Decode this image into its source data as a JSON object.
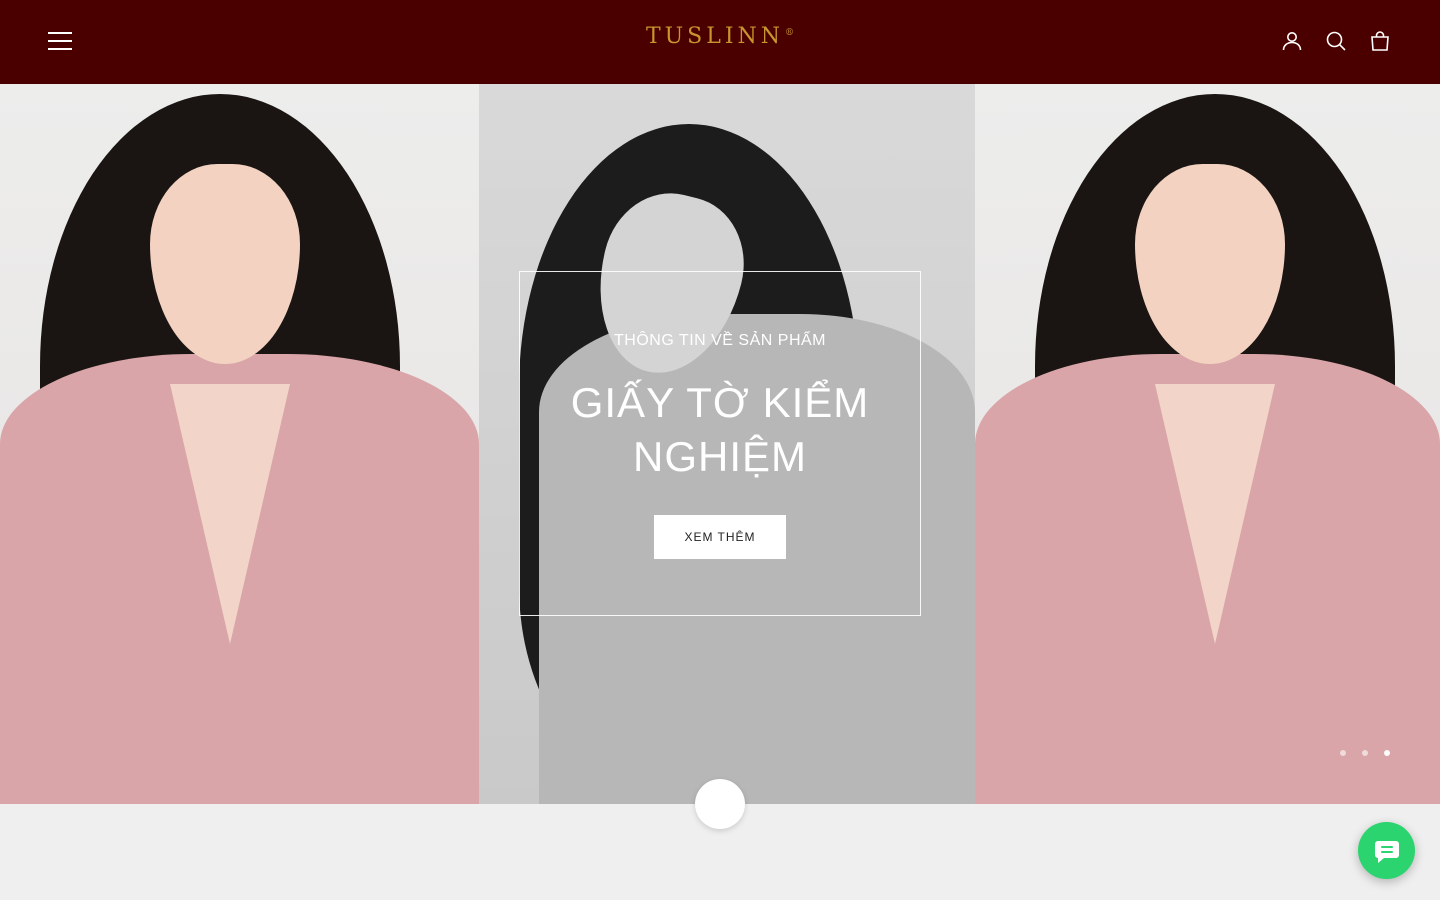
{
  "header": {
    "brand": "TUSLINN",
    "brand_mark": "®",
    "background": "#4b0000",
    "logo_color": "#c8952e",
    "icons": [
      "menu-icon",
      "account-icon",
      "search-icon",
      "cart-icon"
    ]
  },
  "hero": {
    "eyebrow": "THÔNG TIN VỀ SẢN PHẨM",
    "headline_line1": "GIẤY TỜ KIỂM",
    "headline_line2": "NGHIỆM",
    "cta_label": "XEM THÊM",
    "slide_count": 3,
    "active_slide": 3
  },
  "chat": {
    "icon": "chat-bubble-icon",
    "color": "#2bd46e"
  }
}
